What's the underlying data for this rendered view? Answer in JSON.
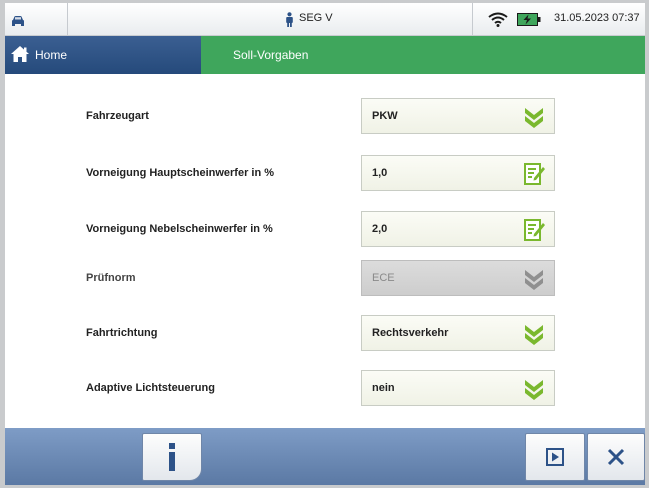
{
  "status_bar": {
    "car_icon": "car-icon",
    "device_icon": "person-icon",
    "device_name": "SEG V",
    "wifi_icon": "wifi-icon",
    "battery_icon": "battery-charging-icon",
    "datetime": "31.05.2023 07:37"
  },
  "nav": {
    "home_label": "Home",
    "title": "Soll-Vorgaben",
    "home_color": "#2d5288",
    "title_color": "#3fa65c"
  },
  "form": {
    "rows": [
      {
        "label": "Fahrzeugart",
        "value": "PKW",
        "control": "dropdown",
        "enabled": true
      },
      {
        "label": "Vorneigung Hauptscheinwerfer in %",
        "value": "1,0",
        "control": "edit",
        "enabled": true
      },
      {
        "label": "Vorneigung Nebelscheinwerfer in %",
        "value": "2,0",
        "control": "edit",
        "enabled": true
      },
      {
        "label": "Prüfnorm",
        "value": "ECE",
        "control": "dropdown",
        "enabled": false
      },
      {
        "label": "Fahrtrichtung",
        "value": "Rechtsverkehr",
        "control": "dropdown",
        "enabled": true
      },
      {
        "label": "Adaptive Lichtsteuerung",
        "value": "nein",
        "control": "dropdown",
        "enabled": true
      }
    ]
  },
  "bottom_bar": {
    "info_icon": "info-icon",
    "next_icon": "play-next-icon",
    "close_icon": "close-icon",
    "bar_color": "#6d8bb6"
  }
}
